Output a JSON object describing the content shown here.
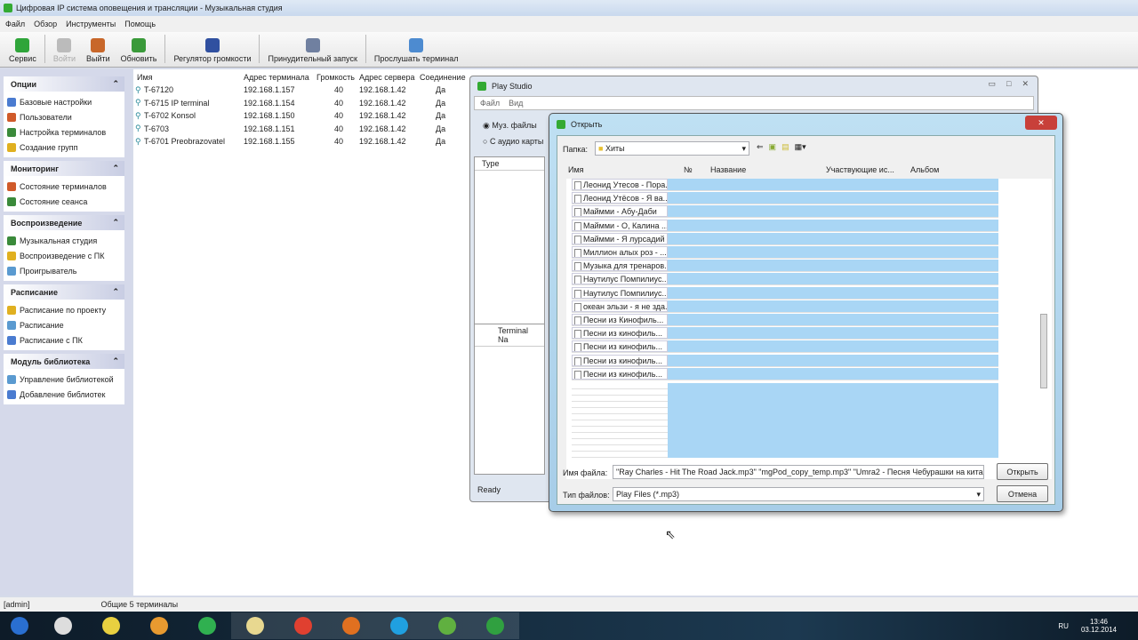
{
  "title": "Цифровая IP система оповещения и трансляции  -  Музыкальная студия",
  "menu": [
    "Файл",
    "Обзор",
    "Инструменты",
    "Помощь"
  ],
  "toolbar": [
    {
      "label": "Сервис",
      "color": "#2fa53a"
    },
    {
      "label": "Войти",
      "color": "#bbbbbb"
    },
    {
      "label": "Выйти",
      "color": "#c8672a"
    },
    {
      "label": "Обновить",
      "color": "#3a9a3a"
    },
    {
      "label": "Регулятор громкости",
      "color": "#3050a0"
    },
    {
      "label": "Принудительный запуск",
      "color": "#7080a0"
    },
    {
      "label": "Прослушать терминал",
      "color": "#4d8bd0"
    }
  ],
  "sidebar": [
    {
      "title": "Опции",
      "items": [
        "Базовые настройки",
        "Пользователи",
        "Настройка терминалов",
        "Создание групп"
      ]
    },
    {
      "title": "Мониторинг",
      "items": [
        "Состояние терминалов",
        "Состояние сеанса"
      ]
    },
    {
      "title": "Воспроизведение",
      "items": [
        "Музыкальная студия",
        "Воспроизведение с ПК",
        "Проигрыватель"
      ]
    },
    {
      "title": "Расписание",
      "items": [
        "Расписание по проекту",
        "Расписание",
        "Расписание с ПК"
      ]
    },
    {
      "title": "Модуль библиотека",
      "items": [
        "Управление библиотекой",
        "Добавление библиотек"
      ]
    }
  ],
  "terminals": {
    "headers": [
      "Имя",
      "Адрес терминала",
      "Громкость",
      "Адрес сервера",
      "Соединение"
    ],
    "rows": [
      [
        "T-67120",
        "192.168.1.157",
        "40",
        "192.168.1.42",
        "Да"
      ],
      [
        "T-6715 IP terminal",
        "192.168.1.154",
        "40",
        "192.168.1.42",
        "Да"
      ],
      [
        "T-6702 Konsol",
        "192.168.1.150",
        "40",
        "192.168.1.42",
        "Да"
      ],
      [
        "T-6703",
        "192.168.1.151",
        "40",
        "192.168.1.42",
        "Да"
      ],
      [
        "T-6701 Preobrazovatel",
        "192.168.1.155",
        "40",
        "192.168.1.42",
        "Да"
      ]
    ]
  },
  "play_studio": {
    "title": "Play Studio",
    "menu": [
      "Файл",
      "Вид"
    ],
    "radio1": "Муз. файлы",
    "radio2": "С аудио карты",
    "col_type": "Type",
    "col_terminal": "Terminal Na",
    "status": "Ready"
  },
  "open_dialog": {
    "title": "Открыть",
    "folder_label": "Папка:",
    "folder": "Хиты",
    "columns": [
      "Имя",
      "№",
      "Название",
      "Участвующие ис...",
      "Альбом"
    ],
    "files": [
      "Леонид Утесов - Пора...",
      "Леонид Утёсов - Я ва...",
      "Маймми - Абу-Даби",
      "Маймми - О, Калина ...",
      "Маймми - Я лурсадий ...",
      "Миллион алых роз - ...",
      "Музыка для тренаров...",
      "Наутилус Помпилиус...",
      "Наутилус Помпилиус...",
      "океан эльзи - я не зда...",
      "Песни из Кинофиль...",
      "Песни из кинофиль...",
      "Песни из кинофиль...",
      "Песни из кинофиль...",
      "Песни из кинофиль..."
    ],
    "filename_label": "Имя файла:",
    "filename": "\"Ray Charles - Hit The Road Jack.mp3\" \"mgPod_copy_temp.mp3\" \"Umra2 - Песня Чебурашки на кита",
    "type_label": "Тип файлов:",
    "type": "Play Files (*.mp3)",
    "open": "Открыть",
    "cancel": "Отмена"
  },
  "status": {
    "user": "[admin]",
    "total": "Общие 5 терминалы"
  },
  "tray": {
    "lang": "RU",
    "time": "13:46",
    "date": "03.12.2014"
  },
  "taskbar": [
    "#2a6fd0",
    "#dddddd",
    "#e8d040",
    "#e89a30",
    "#30b050",
    "#e8d890",
    "#e04030",
    "#e07020",
    "#20a0e0",
    "#60b040",
    "#30a040"
  ]
}
